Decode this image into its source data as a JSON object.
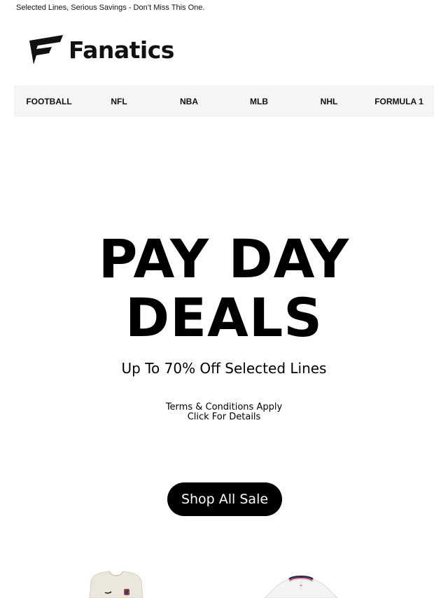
{
  "preheader": "Selected Lines, Serious Savings - Don’t Miss This One.",
  "brand": {
    "name": "Fanatics",
    "icon": "fanatics-flag-logo-icon"
  },
  "nav": {
    "items": [
      {
        "label": "FOOTBALL"
      },
      {
        "label": "NFL"
      },
      {
        "label": "NBA"
      },
      {
        "label": "MLB"
      },
      {
        "label": "NHL"
      },
      {
        "label": "FORMULA 1"
      }
    ]
  },
  "hero": {
    "title_line1": "PAY DAY",
    "title_line2": "DEALS",
    "subtitle": "Up To 70% Off Selected Lines",
    "terms_line1": "Terms & Conditions Apply",
    "terms_line2": "Click For Details",
    "cta_label": "Shop All Sale"
  },
  "products": [
    {
      "icon": "cream-hoodie-product-image"
    },
    {
      "icon": "white-polo-shirt-product-image"
    }
  ]
}
